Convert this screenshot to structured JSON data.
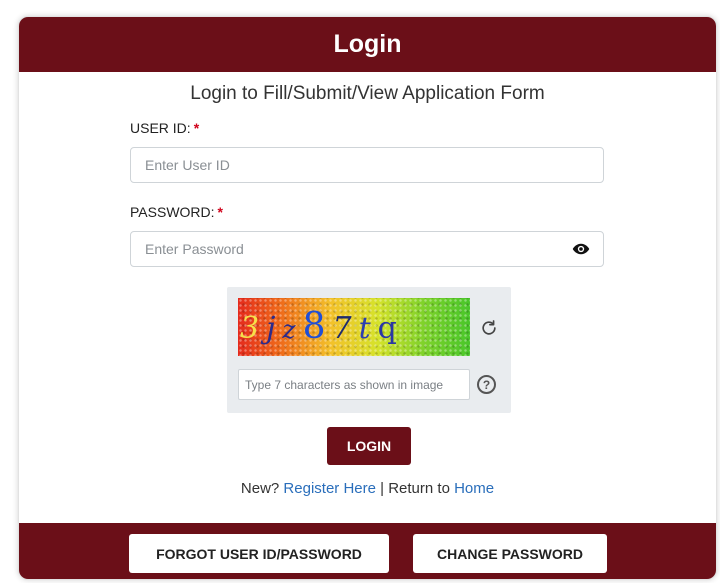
{
  "header": {
    "title": "Login"
  },
  "subtitle": "Login to Fill/Submit/View Application Form",
  "form": {
    "user_id": {
      "label": "USER ID:",
      "required_mark": "*",
      "placeholder": "Enter User ID",
      "value": ""
    },
    "password": {
      "label": "PASSWORD:",
      "required_mark": "*",
      "placeholder": "Enter Password",
      "value": "",
      "toggle_icon": "eye-icon"
    }
  },
  "captcha": {
    "chars": [
      "3",
      "j",
      "z",
      "8",
      "7",
      "t",
      "q"
    ],
    "refresh_icon": "refresh-icon",
    "input_placeholder": "Type 7 characters as shown in image",
    "help_label": "?"
  },
  "login_button": "LOGIN",
  "links": {
    "new_prefix": "New?",
    "register": "Register Here",
    "separator": "|",
    "return_prefix": "Return to",
    "home": "Home"
  },
  "footer": {
    "forgot": "FORGOT USER ID/PASSWORD",
    "change": "CHANGE PASSWORD"
  },
  "colors": {
    "brand": "#6b0f18",
    "link": "#2a6ebb",
    "required": "#d0021b"
  }
}
